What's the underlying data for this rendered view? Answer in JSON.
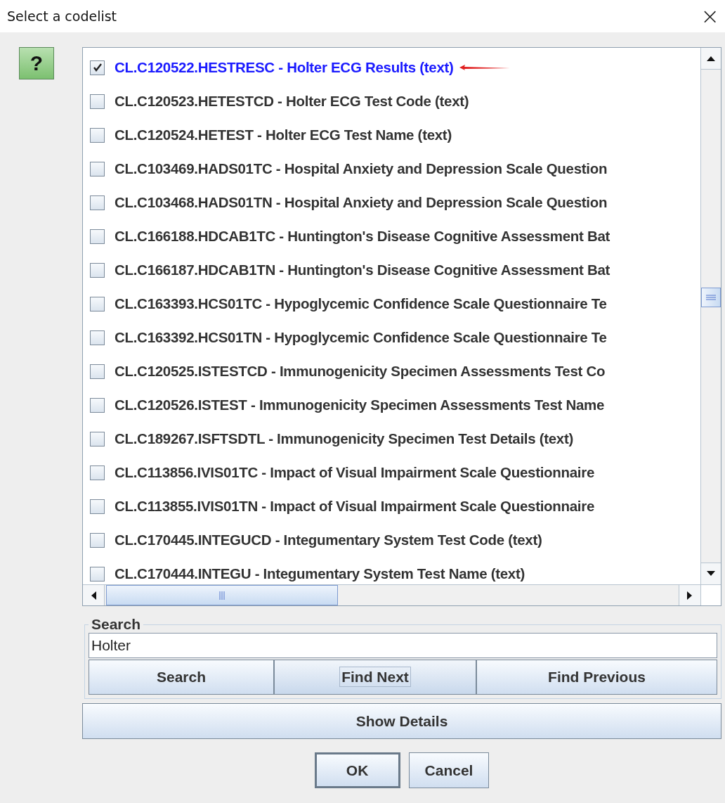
{
  "window": {
    "title": "Select a codelist",
    "close": "×"
  },
  "help": {
    "label": "?"
  },
  "codelists": [
    {
      "text": "CL.C120522.HESTRESC - Holter ECG Results (text)",
      "checked": true,
      "annotated": true
    },
    {
      "text": "CL.C120523.HETESTCD - Holter ECG Test Code (text)",
      "checked": false,
      "annotated": false
    },
    {
      "text": "CL.C120524.HETEST - Holter ECG Test Name (text)",
      "checked": false,
      "annotated": false
    },
    {
      "text": "CL.C103469.HADS01TC - Hospital Anxiety and Depression Scale Question",
      "checked": false,
      "annotated": false
    },
    {
      "text": "CL.C103468.HADS01TN - Hospital Anxiety and Depression Scale Question",
      "checked": false,
      "annotated": false
    },
    {
      "text": "CL.C166188.HDCAB1TC - Huntington's Disease Cognitive Assessment Bat",
      "checked": false,
      "annotated": false
    },
    {
      "text": "CL.C166187.HDCAB1TN - Huntington's Disease Cognitive Assessment Bat",
      "checked": false,
      "annotated": false
    },
    {
      "text": "CL.C163393.HCS01TC - Hypoglycemic Confidence Scale Questionnaire Te",
      "checked": false,
      "annotated": false
    },
    {
      "text": "CL.C163392.HCS01TN - Hypoglycemic Confidence Scale Questionnaire Te",
      "checked": false,
      "annotated": false
    },
    {
      "text": "CL.C120525.ISTESTCD - Immunogenicity Specimen Assessments Test Co",
      "checked": false,
      "annotated": false
    },
    {
      "text": "CL.C120526.ISTEST - Immunogenicity Specimen Assessments Test Name",
      "checked": false,
      "annotated": false
    },
    {
      "text": "CL.C189267.ISFTSDTL - Immunogenicity Specimen Test Details (text)",
      "checked": false,
      "annotated": false
    },
    {
      "text": "CL.C113856.IVIS01TC - Impact of Visual Impairment Scale Questionnaire",
      "checked": false,
      "annotated": false
    },
    {
      "text": "CL.C113855.IVIS01TN - Impact of Visual Impairment Scale Questionnaire",
      "checked": false,
      "annotated": false
    },
    {
      "text": "CL.C170445.INTEGUCD - Integumentary System Test Code (text)",
      "checked": false,
      "annotated": false
    },
    {
      "text": "CL.C170444.INTEGU - Integumentary System Test Name (text)",
      "checked": false,
      "annotated": false
    }
  ],
  "search": {
    "legend": "Search",
    "value": "Holter",
    "buttons": [
      {
        "label": "Search",
        "focused": false
      },
      {
        "label": "Find Next",
        "focused": true
      },
      {
        "label": "Find Previous",
        "focused": false
      }
    ]
  },
  "details_button": "Show Details",
  "buttons": [
    {
      "label": "OK",
      "default": true
    },
    {
      "label": "Cancel",
      "default": false
    }
  ]
}
